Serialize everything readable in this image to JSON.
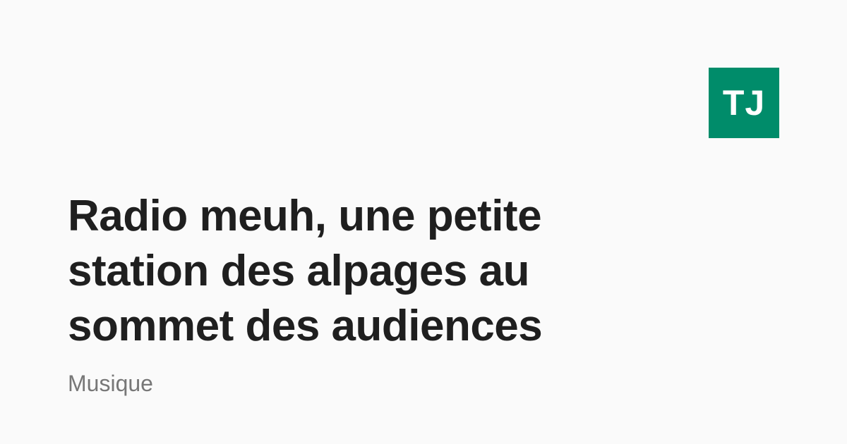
{
  "brand": {
    "logo_text": "TJ",
    "color": "#008c6a"
  },
  "article": {
    "headline": "Radio meuh, une petite station des alpages au sommet des audiences",
    "category": "Musique"
  },
  "colors": {
    "background": "#fafafa",
    "headline": "#1f1f1f",
    "category": "#777777"
  }
}
